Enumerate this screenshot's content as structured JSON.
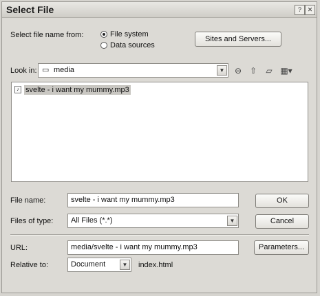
{
  "window": {
    "title": "Select File"
  },
  "source": {
    "label": "Select file name from:",
    "options": [
      "File system",
      "Data sources"
    ],
    "selected_index": 0,
    "sites_button": "Sites and Servers..."
  },
  "look_in": {
    "label": "Look in:",
    "value": "media"
  },
  "files": [
    {
      "name": "svelte - i want my mummy.mp3",
      "selected": true
    }
  ],
  "file_name": {
    "label": "File name:",
    "value": "svelte - i want my mummy.mp3",
    "ok_button": "OK"
  },
  "file_type": {
    "label": "Files of type:",
    "value": "All Files (*.*)",
    "cancel_button": "Cancel"
  },
  "url": {
    "label": "URL:",
    "value": "media/svelte - i want my mummy.mp3",
    "parameters_button": "Parameters..."
  },
  "relative": {
    "label": "Relative to:",
    "value": "Document",
    "file": "index.html"
  }
}
